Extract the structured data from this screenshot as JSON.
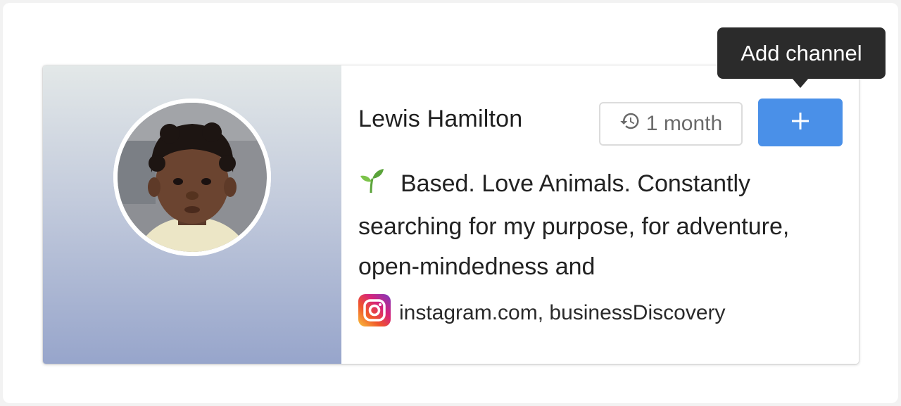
{
  "profile": {
    "name": "Lewis Hamilton",
    "time_label": "1 month",
    "bio": "Based. Love Animals. Constantly searching for my purpose, for adventure, open-mindedness and",
    "bio_emoji_icon": "seedling-icon",
    "source_icon": "instagram-icon",
    "source_text": "instagram.com, businessDiscovery"
  },
  "actions": {
    "add_icon": "plus-icon"
  },
  "tooltip": {
    "text": "Add channel"
  },
  "colors": {
    "accent": "#4a90e8",
    "tooltip_bg": "#2b2b2b",
    "panel_top": "#e3e8e8",
    "panel_bottom": "#97a5cb"
  }
}
